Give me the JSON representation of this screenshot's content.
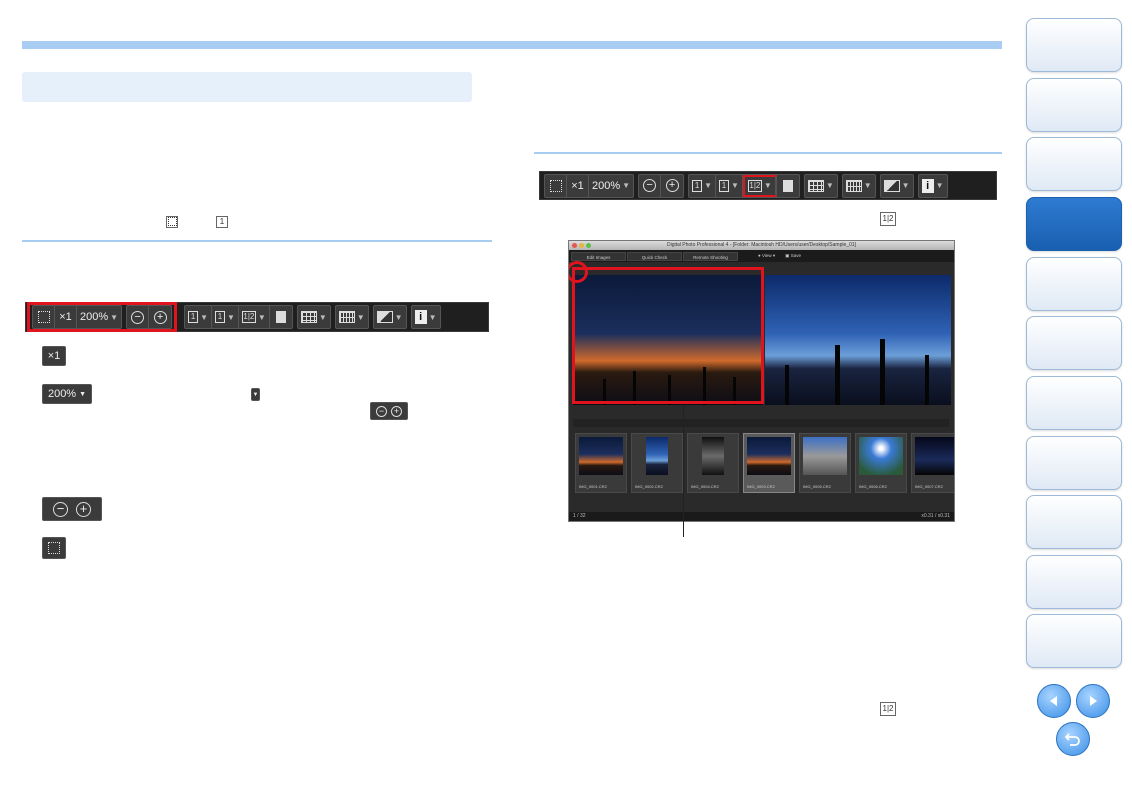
{
  "toolbar": {
    "zoom_x1": "×1",
    "zoom_pct": "200%",
    "minus": "−",
    "plus": "+",
    "frame_label_1": "1",
    "frame_label_12": "1|2",
    "info": "i"
  },
  "inline_icons": {
    "x1": "×1",
    "pct_200": "200%",
    "split": "1|2"
  },
  "app": {
    "title": "Digital Photo Professional 4 - [Folder: Macintosh HD/Users/user/Desktop/Sample_01]",
    "tabs": [
      "Edit Images",
      "Quick Check",
      "Remote Shooting"
    ],
    "view_label": "View",
    "save_label": "Save",
    "thumbnails": [
      {
        "file": "IMG_0001.CR2",
        "style": "dusk"
      },
      {
        "file": "IMG_0002.CR2",
        "style": "blue"
      },
      {
        "file": "IMG_0004.CR2",
        "style": "dark"
      },
      {
        "file": "IMG_0003.CR2",
        "style": "dusk"
      },
      {
        "file": "IMG_0005.CR2",
        "style": "rock"
      },
      {
        "file": "IMG_0006.CR2",
        "style": "sky"
      },
      {
        "file": "IMG_0007.CR2",
        "style": "night"
      }
    ],
    "status_left": "1 / 32",
    "status_right": "x0.31 / x0.31"
  },
  "colors": {
    "accent_light": "#a9cdf2",
    "highlight_red": "#e0141e",
    "nav_active": "#1a5fb0"
  },
  "icons": [
    "fit-window-icon",
    "zoom-out-icon",
    "zoom-in-icon",
    "split-screen-icon",
    "grid-icon",
    "info-icon",
    "prev-page-icon",
    "next-page-icon",
    "return-icon"
  ]
}
